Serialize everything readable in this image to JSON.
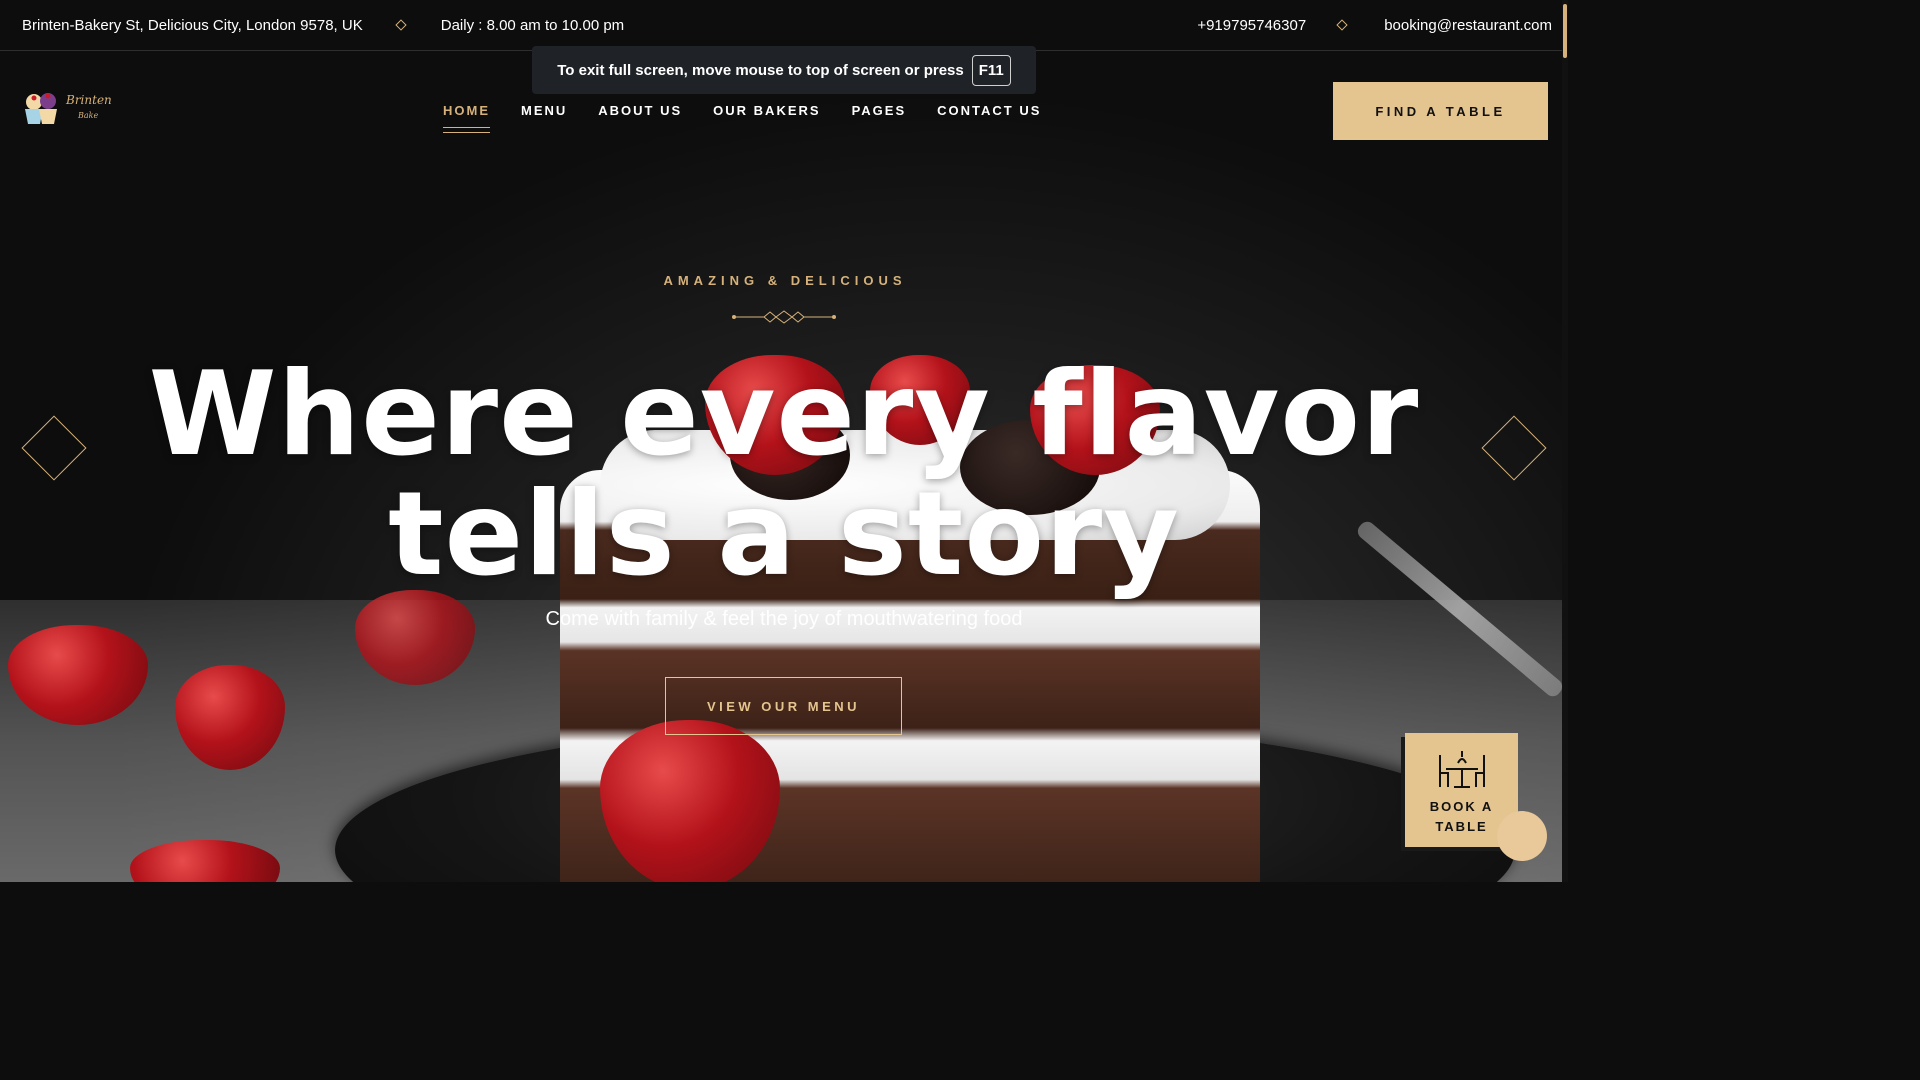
{
  "topbar": {
    "address": "Brinten-Bakery St, Delicious City, London 9578, UK",
    "hours": "Daily : 8.00 am to 10.00 pm",
    "phone": "+919795746307",
    "email": "booking@restaurant.com"
  },
  "fullscreen_notice": {
    "text": "To exit full screen, move mouse to top of screen or press",
    "key": "F11"
  },
  "logo": {
    "name": "Brinten",
    "sub": "Bake"
  },
  "nav": {
    "items": [
      {
        "label": "HOME",
        "active": true
      },
      {
        "label": "MENU"
      },
      {
        "label": "ABOUT US"
      },
      {
        "label": "OUR BAKERS"
      },
      {
        "label": "PAGES"
      },
      {
        "label": "CONTACT US"
      }
    ],
    "cta": "FIND A TABLE"
  },
  "hero": {
    "eyebrow": "AMAZING & DELICIOUS",
    "headline_line1": "Where every flavor",
    "headline_line2": "tells a story",
    "subtitle": "Come with family & feel the joy of mouthwatering food",
    "button": "VIEW OUR MENU"
  },
  "widget": {
    "line1": "BOOK A",
    "line2": "TABLE"
  },
  "colors": {
    "accent": "#d6b27a",
    "accent_fill": "#e4c48f",
    "background": "#0d0d0d"
  },
  "icons": [
    "diamond-separator-icon",
    "table-dining-icon",
    "slider-prev-icon",
    "slider-next-icon"
  ]
}
